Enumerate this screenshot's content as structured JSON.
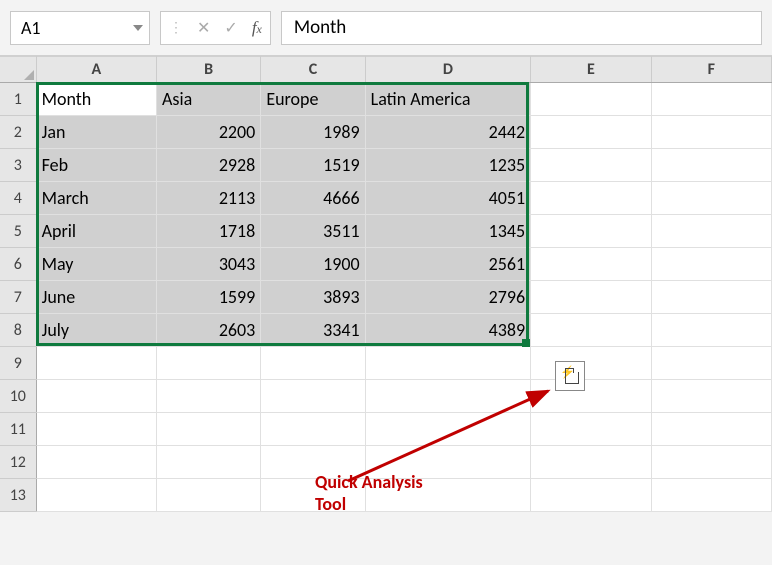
{
  "name_box": "A1",
  "formula_bar_value": "Month",
  "col_letters": [
    "A",
    "B",
    "C",
    "D",
    "E",
    "F"
  ],
  "row_numbers": [
    "1",
    "2",
    "3",
    "4",
    "5",
    "6",
    "7",
    "8",
    "9",
    "10",
    "11",
    "12",
    "13"
  ],
  "headers": [
    "Month",
    "Asia",
    "Europe",
    "Latin America"
  ],
  "rows": [
    {
      "month": "Jan",
      "asia": "2200",
      "europe": "1989",
      "la": "2442"
    },
    {
      "month": "Feb",
      "asia": "2928",
      "europe": "1519",
      "la": "1235"
    },
    {
      "month": "March",
      "asia": "2113",
      "europe": "4666",
      "la": "4051"
    },
    {
      "month": "April",
      "asia": "1718",
      "europe": "3511",
      "la": "1345"
    },
    {
      "month": "May",
      "asia": "3043",
      "europe": "1900",
      "la": "2561"
    },
    {
      "month": "June",
      "asia": "1599",
      "europe": "3893",
      "la": "2796"
    },
    {
      "month": "July",
      "asia": "2603",
      "europe": "3341",
      "la": "4389"
    }
  ],
  "annotation": {
    "line1": "Quick Analysis",
    "line2": "Tool"
  }
}
